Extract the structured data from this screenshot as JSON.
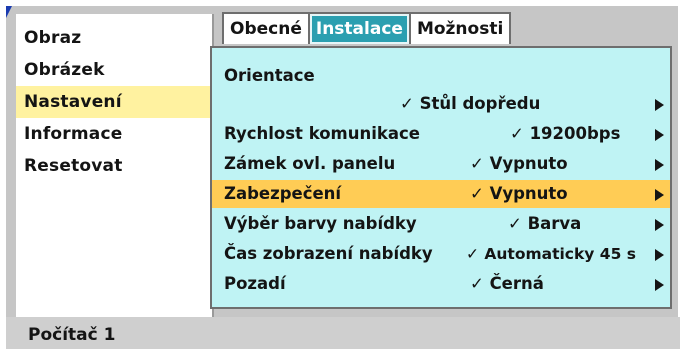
{
  "colors": {
    "selected_menu_bg": "#fff2a0",
    "active_tab_bg": "#2b9fb0",
    "content_bg": "#bff3f4",
    "highlight_row_bg": "#ffcc55"
  },
  "menu": {
    "items": [
      {
        "label": "Obraz",
        "selected": false
      },
      {
        "label": "Obrázek",
        "selected": false
      },
      {
        "label": "Nastavení",
        "selected": true
      },
      {
        "label": "Informace",
        "selected": false
      },
      {
        "label": "Resetovat",
        "selected": false
      }
    ]
  },
  "tabs": [
    {
      "label": "Obecné",
      "active": false
    },
    {
      "label": "Instalace",
      "active": true
    },
    {
      "label": "Možnosti",
      "active": false
    }
  ],
  "settings": {
    "orientace": {
      "label": "Orientace",
      "value": "✓ Stůl dopředu",
      "arrow_icon": "triangle-right-icon"
    },
    "rychlost": {
      "label": "Rychlost komunikace",
      "value": "✓ 19200bps",
      "arrow_icon": "triangle-right-icon"
    },
    "zamek": {
      "label": "Zámek ovl. panelu",
      "value": "✓ Vypnuto",
      "arrow_icon": "triangle-right-icon"
    },
    "zabezpeceni": {
      "label": "Zabezpečení",
      "value": "✓ Vypnuto",
      "arrow_icon": "triangle-right-icon",
      "highlighted": true
    },
    "vyber_barvy": {
      "label": "Výběr barvy nabídky",
      "value": "✓ Barva",
      "arrow_icon": "triangle-right-icon"
    },
    "cas_zobrazeni": {
      "label": "Čas zobrazení nabídky",
      "value": "✓ Automaticky 45 s",
      "arrow_icon": "triangle-right-icon"
    },
    "pozadi": {
      "label": "Pozadí",
      "value": "✓ Černá",
      "arrow_icon": "triangle-right-icon"
    }
  },
  "status": {
    "source": "Počítač 1"
  }
}
